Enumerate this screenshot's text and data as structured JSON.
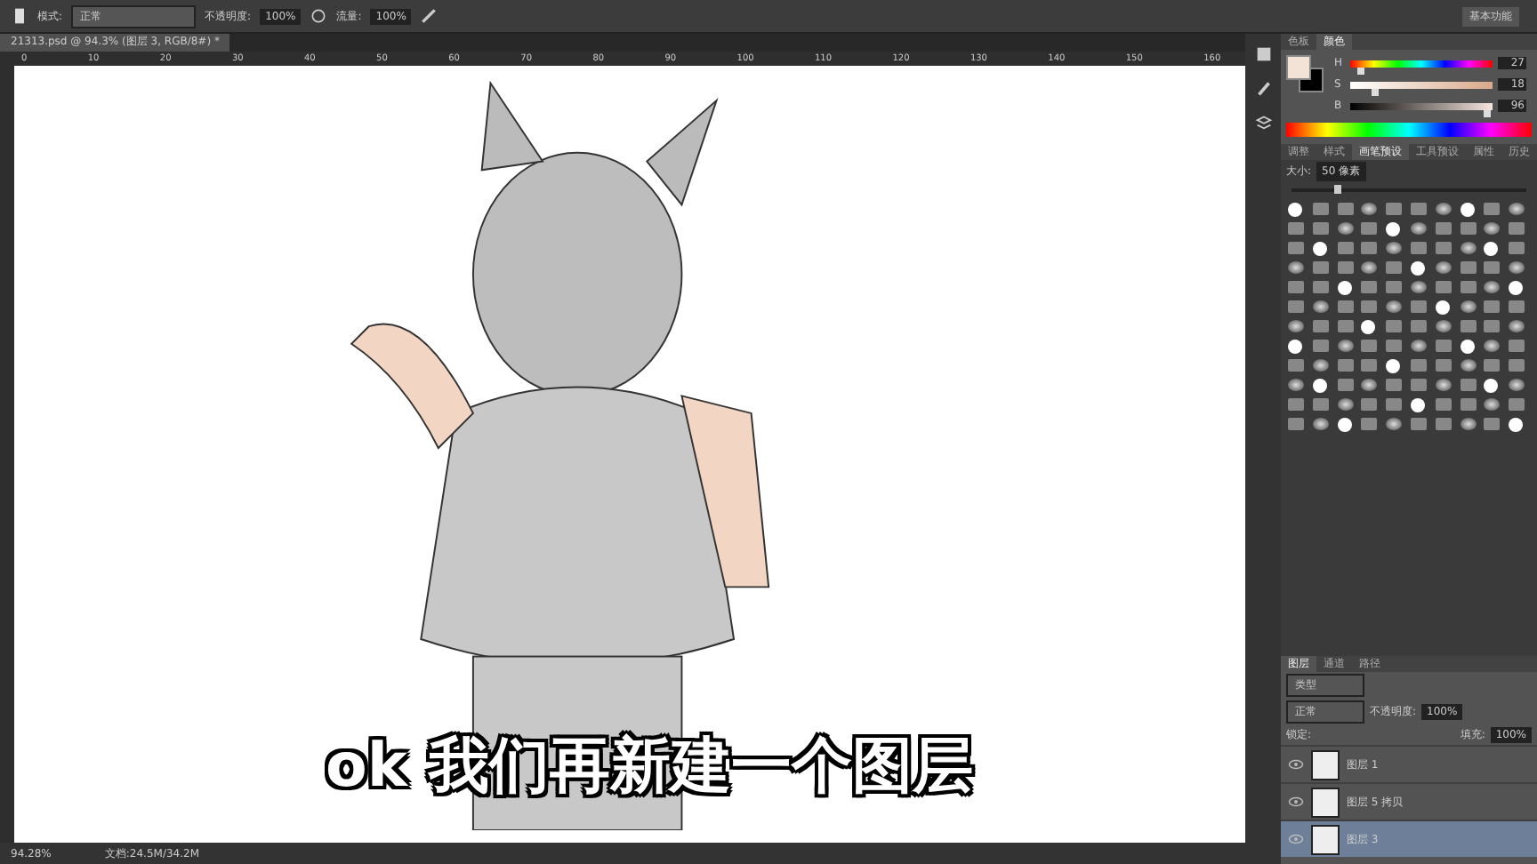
{
  "options_bar": {
    "mode_label": "模式:",
    "mode_value": "正常",
    "opacity_label": "不透明度:",
    "opacity_value": "100%",
    "flow_label": "流量:",
    "flow_value": "100%",
    "workspace": "基本功能"
  },
  "document_tab": {
    "title": "21313.psd @ 94.3% (图层 3, RGB/8#) *"
  },
  "ruler": [
    "0",
    "10",
    "20",
    "30",
    "40",
    "50",
    "60",
    "70",
    "80",
    "90",
    "100",
    "110",
    "120",
    "130",
    "140",
    "150",
    "160"
  ],
  "subtitle": "ok 我们再新建一个图层",
  "color_panel": {
    "tabs": [
      {
        "label": "色板",
        "selected": false
      },
      {
        "label": "颜色",
        "selected": true
      }
    ],
    "sliders": [
      {
        "label": "H",
        "level": 0.08,
        "reading": "27"
      },
      {
        "label": "S",
        "level": 0.18,
        "reading": "18"
      },
      {
        "label": "B",
        "level": 0.96,
        "reading": "96"
      }
    ]
  },
  "brush_panel": {
    "tabs": [
      {
        "label": "调整",
        "selected": false
      },
      {
        "label": "样式",
        "selected": false
      },
      {
        "label": "画笔预设",
        "selected": true
      },
      {
        "label": "工具预设",
        "selected": false
      },
      {
        "label": "属性",
        "selected": false
      },
      {
        "label": "历史",
        "selected": false
      }
    ],
    "size_label": "大小:",
    "size_value": "50 像素",
    "size_slider": {
      "level": 0.2
    }
  },
  "layers_panel": {
    "tabs": [
      {
        "label": "图层",
        "selected": true
      },
      {
        "label": "通道",
        "selected": false
      },
      {
        "label": "路径",
        "selected": false
      }
    ],
    "filter": "类型",
    "blend_mode": "正常",
    "opacity_label": "不透明度:",
    "opacity_value": "100%",
    "lock_label": "锁定:",
    "fill_label": "填充:",
    "fill_value": "100%",
    "layers": [
      {
        "name": "图层 1",
        "selected": false
      },
      {
        "name": "图层 5 拷贝",
        "selected": false
      },
      {
        "name": "图层 3",
        "selected": true
      }
    ]
  },
  "status_bar": {
    "zoom": "94.28%",
    "doc_info": "文档:24.5M/34.2M"
  }
}
